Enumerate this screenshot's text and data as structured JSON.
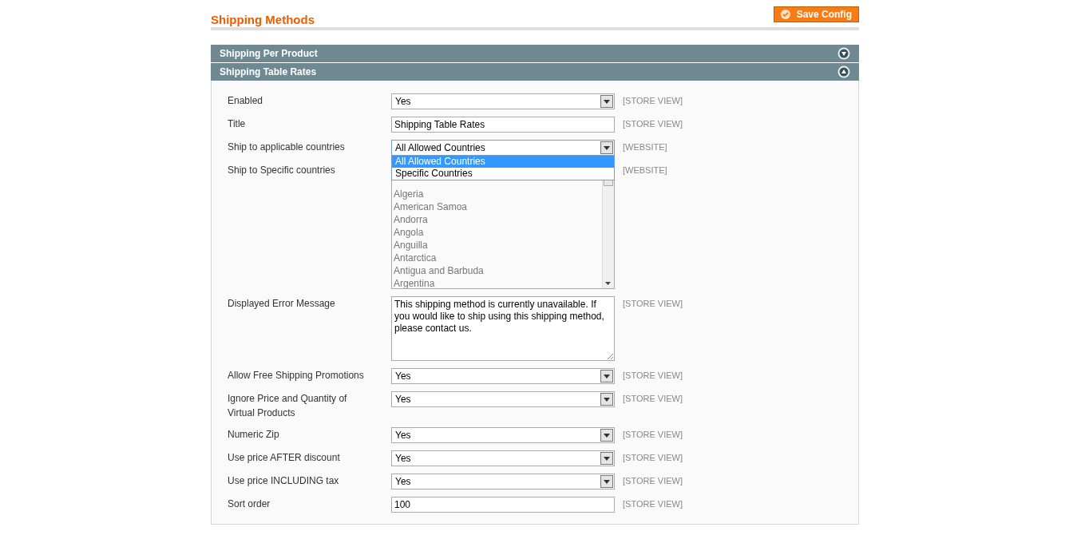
{
  "page_title": "Shipping Methods",
  "save_button": "Save Config",
  "sections": [
    {
      "title": "Shipping Per Product",
      "expanded": false
    },
    {
      "title": "Shipping Table Rates",
      "expanded": true
    }
  ],
  "fields": [
    {
      "kind": "select",
      "label": "Enabled",
      "value": "Yes",
      "scope": "[STORE VIEW]"
    },
    {
      "kind": "text",
      "label": "Title",
      "value": "Shipping Table Rates",
      "scope": "[STORE VIEW]"
    },
    {
      "kind": "select",
      "label": "Ship to applicable countries",
      "value": "All Allowed Countries",
      "scope": "[WEBSITE]",
      "expanded": true,
      "options": [
        {
          "label": "All Allowed Countries",
          "selected": true
        },
        {
          "label": "Specific Countries",
          "selected": false
        }
      ]
    },
    {
      "kind": "multiselect",
      "label": "Ship to Specific countries",
      "scope": "[WEBSITE]",
      "disabled": true,
      "items": [
        "Algeria",
        "American Samoa",
        "Andorra",
        "Angola",
        "Anguilla",
        "Antarctica",
        "Antigua and Barbuda",
        "Argentina"
      ]
    },
    {
      "kind": "textarea",
      "label": "Displayed Error Message",
      "value": "This shipping method is currently unavailable. If you would like to ship using this shipping method, please contact us.",
      "scope": "[STORE VIEW]"
    },
    {
      "kind": "select",
      "label": "Allow Free Shipping Promotions",
      "value": "Yes",
      "scope": "[STORE VIEW]"
    },
    {
      "kind": "select",
      "label": "Ignore Price and Quantity of Virtual Products",
      "value": "Yes",
      "scope": "[STORE VIEW]"
    },
    {
      "kind": "select",
      "label": "Numeric Zip",
      "value": "Yes",
      "scope": "[STORE VIEW]"
    },
    {
      "kind": "select",
      "label": "Use price AFTER discount",
      "value": "Yes",
      "scope": "[STORE VIEW]"
    },
    {
      "kind": "select",
      "label": "Use price INCLUDING tax",
      "value": "Yes",
      "scope": "[STORE VIEW]"
    },
    {
      "kind": "text",
      "label": "Sort order",
      "value": "100",
      "scope": "[STORE VIEW]"
    }
  ]
}
